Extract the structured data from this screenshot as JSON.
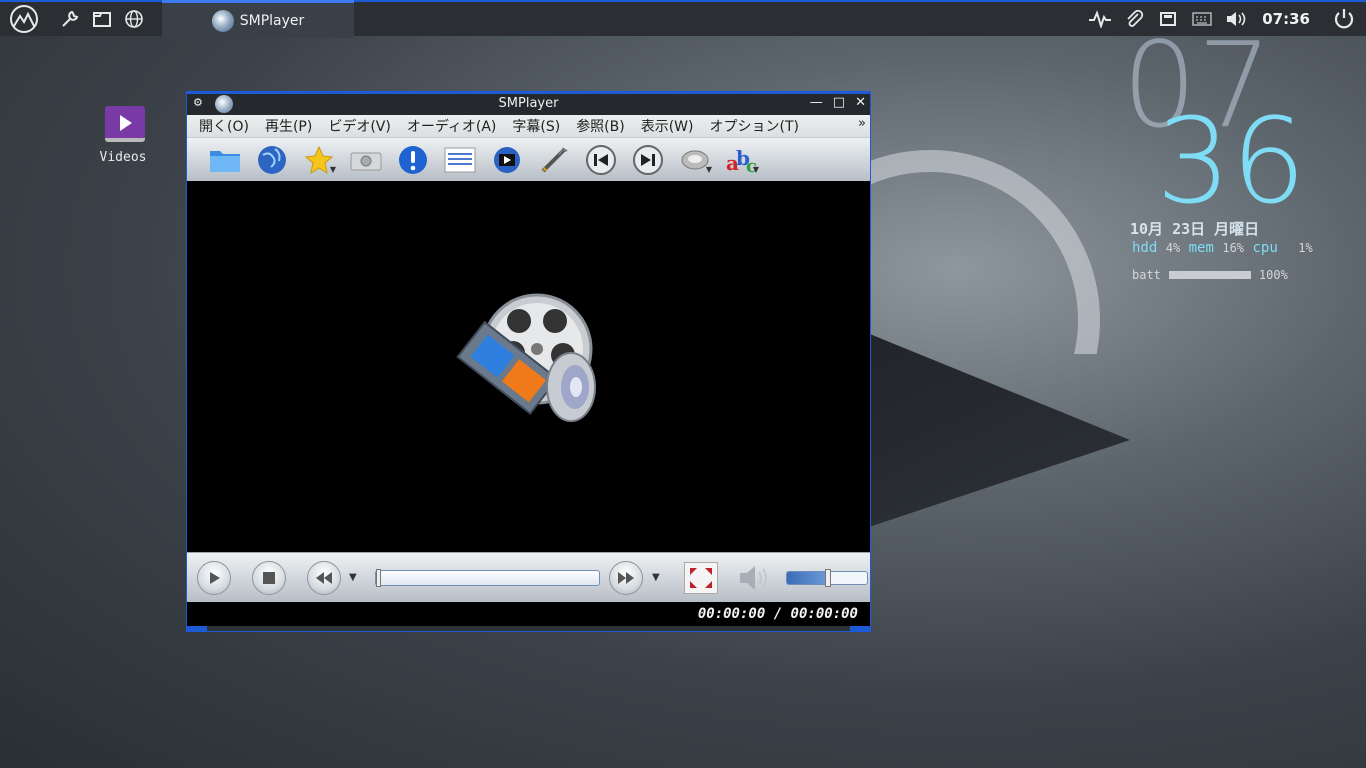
{
  "taskbar": {
    "left_icons": [
      "logo-icon",
      "wrench-icon",
      "files-icon",
      "globe-icon"
    ],
    "task_title": "SMPlayer",
    "tray_icons": [
      "activity-icon",
      "paperclip-icon",
      "network-icon",
      "keyboard-icon",
      "volume-icon"
    ],
    "clock": "07:36",
    "power_icon": "power-icon"
  },
  "desktop": {
    "videos_label": "Videos"
  },
  "conky": {
    "hour": "07",
    "minute": "36",
    "date": "10月 23日 月曜日",
    "hdd_label": "hdd",
    "hdd_value": "4%",
    "mem_label": "mem",
    "mem_value": "16%",
    "cpu_label": "cpu",
    "cpu_value": "1%",
    "batt_label": "batt",
    "batt_value": "100%"
  },
  "window": {
    "title": "SMPlayer",
    "menu": [
      "開く(O)",
      "再生(P)",
      "ビデオ(V)",
      "オーディオ(A)",
      "字幕(S)",
      "参照(B)",
      "表示(W)",
      "オプション(T)"
    ],
    "menu_more": "»",
    "toolbar": [
      "open-folder-icon",
      "globe-icon",
      "favorites-star-icon",
      "screenshot-camera-icon",
      "info-icon",
      "playlist-icon",
      "video-icon",
      "preferences-tools-icon",
      "previous-icon",
      "next-icon",
      "audio-track-icon",
      "subtitles-abc-icon"
    ],
    "time_display": "00:00:00 / 00:00:00",
    "volume_level": 0.5
  }
}
